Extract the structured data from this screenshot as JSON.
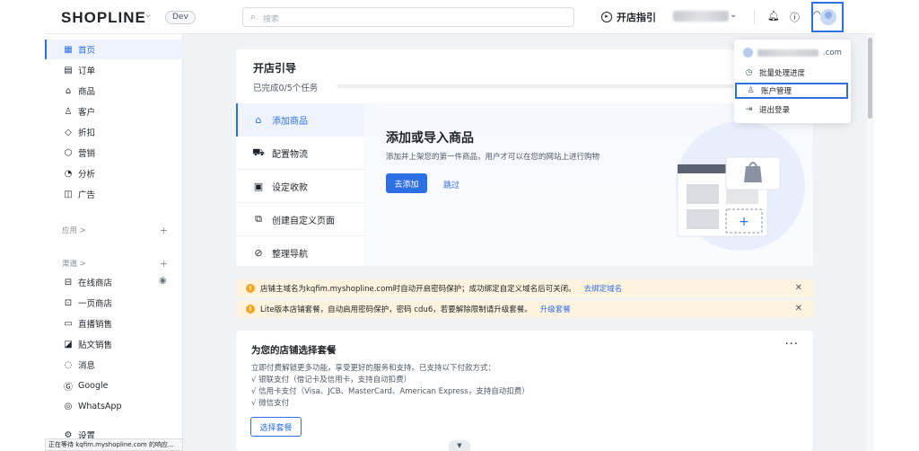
{
  "header": {
    "logo": "SHOPLINE",
    "env_badge": "Dev",
    "search_placeholder": "搜索",
    "guide_label": "开店指引"
  },
  "sidebar": {
    "items": [
      {
        "label": "首页",
        "icon": "grid-icon",
        "active": true
      },
      {
        "label": "订单",
        "icon": "order-icon"
      },
      {
        "label": "商品",
        "icon": "bag-icon"
      },
      {
        "label": "客户",
        "icon": "user-icon"
      },
      {
        "label": "折扣",
        "icon": "tag-icon"
      },
      {
        "label": "营销",
        "icon": "megaphone-icon"
      },
      {
        "label": "分析",
        "icon": "pie-chart-icon"
      },
      {
        "label": "广告",
        "icon": "ad-icon"
      }
    ],
    "apps_section": "应用 >",
    "channels_section": "渠道 >",
    "channels": [
      {
        "label": "在线商店",
        "icon": "store-icon"
      },
      {
        "label": "一页商店",
        "icon": "page-icon"
      },
      {
        "label": "直播销售",
        "icon": "video-icon"
      },
      {
        "label": "贴文销售",
        "icon": "post-icon"
      },
      {
        "label": "消息",
        "icon": "chat-icon"
      },
      {
        "label": "Google",
        "icon": "google-icon"
      },
      {
        "label": "WhatsApp",
        "icon": "whatsapp-icon"
      }
    ],
    "settings": "设置"
  },
  "guide": {
    "title": "开店引导",
    "progress_text": "已完成0/5个任务",
    "progress_fraction": 0,
    "steps": [
      {
        "label": "添加商品",
        "icon": "bag-icon",
        "active": true
      },
      {
        "label": "配置物流",
        "icon": "truck-icon"
      },
      {
        "label": "设定收款",
        "icon": "wallet-icon"
      },
      {
        "label": "创建自定义页面",
        "icon": "page-icon"
      },
      {
        "label": "整理导航",
        "icon": "compass-icon"
      }
    ],
    "panel": {
      "title": "添加或导入商品",
      "desc": "添加并上架您的第一件商品，用户才可以在您的网站上进行购物",
      "primary_btn": "去添加",
      "skip_link": "跳过"
    }
  },
  "banners": [
    {
      "text": "店铺主域名为kqfim.myshopline.com时自动开启密码保护；成功绑定自定义域名后可关闭。",
      "link": "去绑定域名"
    },
    {
      "text": "Lite版本店铺套餐，自动启用密码保护，密码 cdu6，若要解除限制请升级套餐。",
      "link": "升级套餐"
    }
  ],
  "plan": {
    "title": "为您的店铺选择套餐",
    "lines": [
      "立即付费解锁更多功能，享受更好的服务和支持。已支持以下付款方式：",
      "√ 银联支付（借记卡及信用卡，支持自动扣费）",
      "√ 信用卡支付（Visa、JCB、MasterCard、American Express，支持自动扣费）",
      "√ 微信支付"
    ],
    "button": "选择套餐"
  },
  "dropdown": {
    "email_tail": ".com",
    "items": [
      {
        "label": "批量处理进度",
        "icon": "clock-icon"
      },
      {
        "label": "账户管理",
        "icon": "account-icon",
        "highlighted": true
      },
      {
        "label": "退出登录",
        "icon": "logout-icon"
      }
    ]
  },
  "status": "正在等待 kqfim.myshopline.com 的响应...",
  "colors": {
    "accent": "#2f6fe4",
    "warning_bg": "#fdf3df",
    "warning_icon": "#f5a623"
  }
}
